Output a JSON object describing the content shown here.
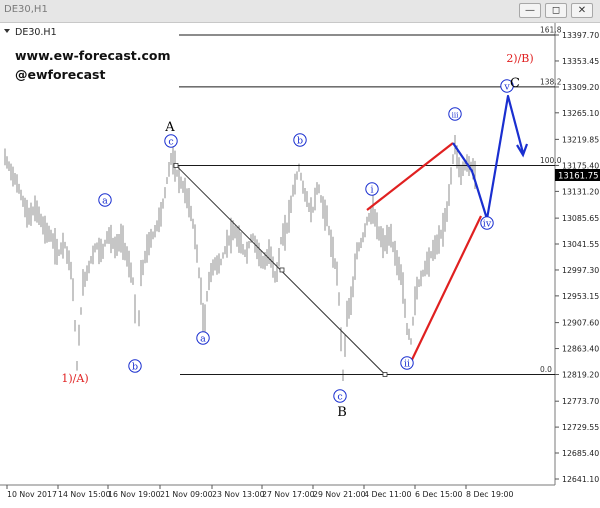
{
  "window": {
    "title": "DE30,H1",
    "buttons": [
      "—",
      "◻",
      "✕"
    ]
  },
  "chart_info": {
    "symbol": "DE30.H1"
  },
  "watermark": {
    "line1": "www.ew-forecast.com",
    "line2": "@ewforecast"
  },
  "chart_data": {
    "type": "line",
    "y_ticks": [
      "13397.70",
      "13353.45",
      "13309.20",
      "13265.10",
      "13219.85",
      "13175.40",
      "13131.20",
      "13085.65",
      "13041.55",
      "12997.30",
      "12953.15",
      "12907.60",
      "12863.40",
      "12819.20",
      "12773.70",
      "12729.55",
      "12685.40",
      "12641.10"
    ],
    "x_ticks": [
      "10 Nov 2017",
      "14 Nov 15:00",
      "16 Nov 19:00",
      "21 Nov 09:00",
      "23 Nov 13:00",
      "27 Nov 17:00",
      "29 Nov 21:00",
      "4 Dec 11:00",
      "6 Dec 15:00",
      "8 Dec 19:00"
    ],
    "ylim": [
      12641.1,
      13397.7
    ],
    "current_price": "13161.75",
    "fib_levels": [
      {
        "label": "161.8",
        "price": 13397.7
      },
      {
        "label": "138.2",
        "price": 13309.2
      },
      {
        "label": "100.0",
        "price": 13175.4
      },
      {
        "label": "0.0",
        "price": 12819.2
      }
    ],
    "wave_labels": [
      {
        "text": "1)/A)",
        "color": "#e02020"
      },
      {
        "text": "2)/B)",
        "color": "#e02020"
      },
      {
        "text": "A",
        "color": "#000000"
      },
      {
        "text": "B",
        "color": "#000000"
      },
      {
        "text": "C",
        "color": "#000000"
      },
      {
        "text": "a",
        "color": "#1a2fd0"
      },
      {
        "text": "b",
        "color": "#1a2fd0"
      },
      {
        "text": "c",
        "color": "#1a2fd0"
      },
      {
        "text": "i",
        "color": "#1a2fd0"
      },
      {
        "text": "ii",
        "color": "#1a2fd0"
      },
      {
        "text": "iii",
        "color": "#1a2fd0"
      },
      {
        "text": "iv",
        "color": "#1a2fd0"
      },
      {
        "text": "v",
        "color": "#1a2fd0"
      }
    ],
    "colors": {
      "price": "#8c8c8c",
      "red": "#e02020",
      "blue": "#1a2fd0",
      "fib": "#1a1a1a"
    }
  }
}
